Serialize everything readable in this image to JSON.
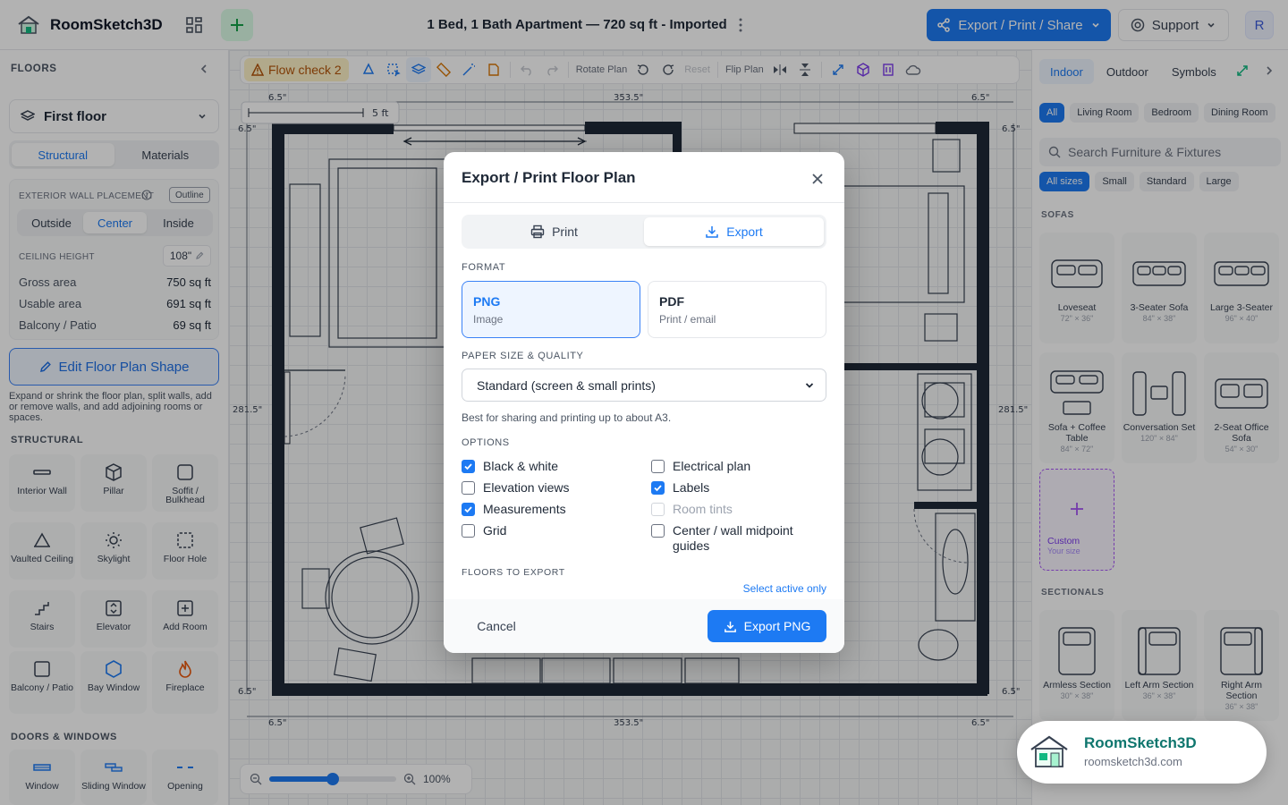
{
  "app": {
    "name": "RoomSketch3D",
    "doc_title": "1 Bed, 1 Bath Apartment — 720 sq ft - Imported",
    "export_button": "Export / Print / Share",
    "support_button": "Support",
    "avatar_initial": "R"
  },
  "left": {
    "floors_heading": "FLOORS",
    "floor_selected": "First floor",
    "tabs": [
      "Structural",
      "Materials"
    ],
    "wall_placement_label": "EXTERIOR WALL PLACEMENT",
    "outline_label": "Outline",
    "wall_options": [
      "Outside",
      "Center",
      "Inside"
    ],
    "ceiling_label": "CEILING HEIGHT",
    "ceiling_value": "108\"",
    "stats": [
      {
        "label": "Gross area",
        "value": "750 sq ft"
      },
      {
        "label": "Usable area",
        "value": "691 sq ft"
      },
      {
        "label": "Balcony / Patio",
        "value": "69 sq ft"
      }
    ],
    "edit_button": "Edit Floor Plan Shape",
    "edit_note": "Expand or shrink the floor plan, split walls, add or remove walls, and add adjoining rooms or spaces.",
    "structural_heading": "STRUCTURAL",
    "structural_tools": [
      "Interior Wall",
      "Pillar",
      "Soffit / Bulkhead",
      "Vaulted Ceiling",
      "Skylight",
      "Floor Hole",
      "Stairs",
      "Elevator",
      "Add Room",
      "Balcony / Patio",
      "Bay Window",
      "Fireplace"
    ],
    "doors_heading": "DOORS & WINDOWS",
    "door_tools": [
      "Window",
      "Sliding Window",
      "Opening"
    ]
  },
  "canvas": {
    "flow_check": "Flow check 2",
    "rotate_label": "Rotate Plan",
    "reset_label": "Reset",
    "flip_label": "Flip Plan",
    "scale_label": "5 ft",
    "dims": {
      "top_left": "6.5\"",
      "top_mid": "353.5\"",
      "top_right": "6.5\"",
      "side_left": "281.5\"",
      "side_right": "281.5\"",
      "bottom_left": "6.5\"",
      "bottom_mid": "353.5\"",
      "bottom_right": "6.5\"",
      "corner": "6.5\""
    },
    "zoom_value": "100%",
    "zoom_level": 0.5
  },
  "right": {
    "tabs": [
      "Indoor",
      "Outdoor",
      "Symbols"
    ],
    "room_chips": [
      "All",
      "Living Room",
      "Bedroom",
      "Dining Room"
    ],
    "search_placeholder": "Search Furniture & Fixtures",
    "size_chips": [
      "All sizes",
      "Small",
      "Standard",
      "Large"
    ],
    "sofas_heading": "SOFAS",
    "sofas": [
      {
        "name": "Loveseat",
        "size": "72\" × 36\""
      },
      {
        "name": "3-Seater Sofa",
        "size": "84\" × 38\""
      },
      {
        "name": "Large 3-Seater",
        "size": "96\" × 40\""
      },
      {
        "name": "Sofa + Coffee Table",
        "size": "84\" × 72\""
      },
      {
        "name": "Conversation Set",
        "size": "120\" × 84\""
      },
      {
        "name": "2-Seat Office Sofa",
        "size": "54\" × 30\""
      }
    ],
    "custom_label": "Custom",
    "custom_sub": "Your size",
    "sectionals_heading": "SECTIONALS",
    "sectionals": [
      {
        "name": "Armless Section",
        "size": "30\" × 38\""
      },
      {
        "name": "Left Arm Section",
        "size": "36\" × 38\""
      },
      {
        "name": "Right Arm Section",
        "size": "36\" × 38\""
      }
    ]
  },
  "modal": {
    "title": "Export / Print Floor Plan",
    "tabs": [
      "Print",
      "Export"
    ],
    "format_label": "FORMAT",
    "formats": [
      {
        "title": "PNG",
        "sub": "Image"
      },
      {
        "title": "PDF",
        "sub": "Print / email"
      }
    ],
    "paper_label": "PAPER SIZE & QUALITY",
    "paper_value": "Standard (screen & small prints)",
    "paper_help": "Best for sharing and printing up to about A3.",
    "options_label": "OPTIONS",
    "options": [
      {
        "label": "Black & white",
        "checked": true
      },
      {
        "label": "Electrical plan",
        "checked": false
      },
      {
        "label": "Elevation views",
        "checked": false
      },
      {
        "label": "Labels",
        "checked": true
      },
      {
        "label": "Measurements",
        "checked": true
      },
      {
        "label": "Room tints",
        "checked": false
      },
      {
        "label": "Grid",
        "checked": false
      },
      {
        "label": "Center / wall midpoint guides",
        "checked": false
      }
    ],
    "floors_label": "FLOORS TO EXPORT",
    "select_active": "Select active only",
    "cancel": "Cancel",
    "export": "Export PNG"
  },
  "badge": {
    "title": "RoomSketch3D",
    "url": "roomsketch3d.com"
  }
}
